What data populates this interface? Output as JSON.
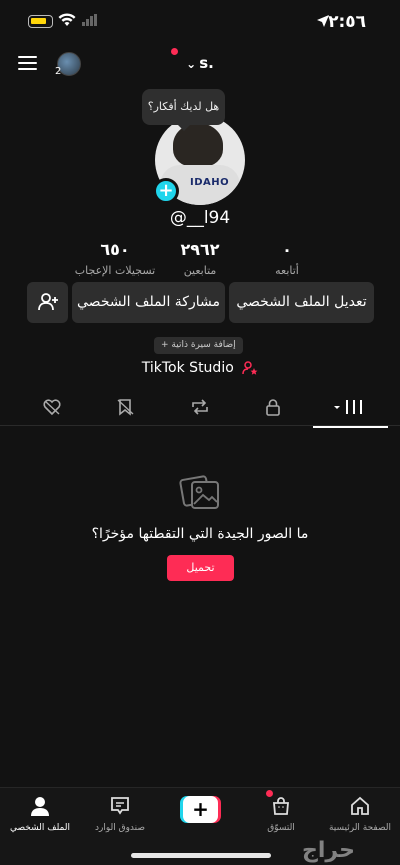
{
  "status": {
    "time": "٢:٥٦"
  },
  "header": {
    "handle": "s.",
    "avatar_count": "2"
  },
  "profile": {
    "bubble": "هل لديك أفكار؟",
    "avatar_text": "IDAHO",
    "username": "@__l94",
    "stats": [
      {
        "value": "٠",
        "label": "أتابعه"
      },
      {
        "value": "٢٩٦٢",
        "label": "متابعين"
      },
      {
        "value": "٦٥٠",
        "label": "تسجيلات الإعجاب"
      }
    ],
    "edit_label": "تعديل الملف الشخصي",
    "share_label": "مشاركة الملف الشخصي",
    "bio_label": "+ إضافة سيرة ذاتية",
    "studio_label": "TikTok Studio"
  },
  "tabs": [
    {
      "icon": "videos-grid-icon",
      "active": true
    },
    {
      "icon": "lock-icon"
    },
    {
      "icon": "repost-icon"
    },
    {
      "icon": "favorites-icon"
    },
    {
      "icon": "liked-icon"
    }
  ],
  "empty_state": {
    "text": "ما الصور الجيدة التي التقطتها مؤخرًا؟",
    "upload_label": "تحميل"
  },
  "nav": {
    "home": "الصفحة الرئيسية",
    "shop": "التسوّق",
    "create": "+",
    "inbox": "صندوق الوارد",
    "profile": "الملف الشخصي"
  },
  "watermark": "حراج",
  "colors": {
    "accent": "#fe2c55",
    "cyan": "#20d5ec",
    "background": "#121212"
  }
}
